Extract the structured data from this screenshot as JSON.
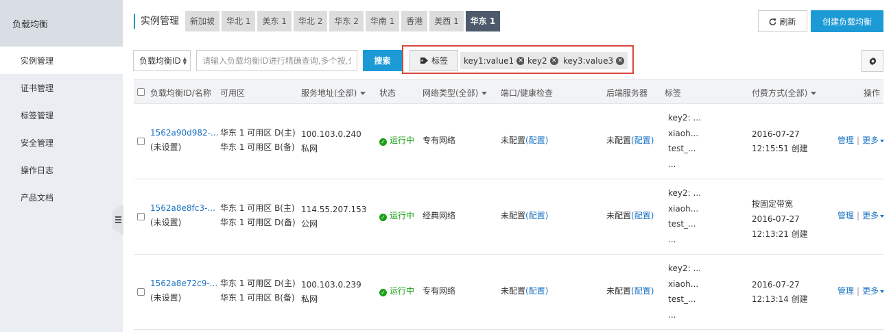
{
  "sidebar": {
    "title": "负载均衡",
    "items": [
      {
        "label": "实例管理",
        "active": true
      },
      {
        "label": "证书管理"
      },
      {
        "label": "标签管理"
      },
      {
        "label": "安全管理"
      },
      {
        "label": "操作日志"
      },
      {
        "label": "产品文档"
      }
    ]
  },
  "header": {
    "title": "实例管理",
    "regions": [
      "新加坡",
      "华北 1",
      "美东 1",
      "华北 2",
      "华东 2",
      "华南 1",
      "香港",
      "美西 1",
      "华东 1"
    ],
    "active_region": "华东 1",
    "refresh_label": "刷新",
    "create_label": "创建负载均衡"
  },
  "filter": {
    "select_value": "负载均衡ID",
    "search_placeholder": "请输入负载均衡ID进行精确查询,多个按,分",
    "search_label": "搜索",
    "tag_label": "标签",
    "tag_chips": [
      "key1:value1",
      "key2",
      "key3:value3"
    ]
  },
  "table": {
    "headers": {
      "id_name": "负载均衡ID/名称",
      "zone": "可用区",
      "address": "服务地址(全部)",
      "status": "状态",
      "network": "网络类型(全部)",
      "port": "端口/健康检查",
      "backend": "后端服务器",
      "tags": "标签",
      "billing": "付费方式(全部)",
      "actions": "操作"
    },
    "rows": [
      {
        "id": "1562a90d982-...",
        "name": "(未设置)",
        "zone_main": "华东 1 可用区 D(主)",
        "zone_backup": "华东 1 可用区 B(备)",
        "ip": "100.103.0.240",
        "ip_type": "私网",
        "status": "运行中",
        "network": "专有网络",
        "port_prefix": "未配置",
        "port_link": "(配置)",
        "backend_prefix": "未配置",
        "backend_link": "(配置)",
        "tags": [
          "key2: ...",
          "xiaoh...",
          "test_...",
          "..."
        ],
        "billing_note": "",
        "billing_date": "2016-07-27",
        "billing_time": "12:15:51 创建",
        "manage": "管理",
        "more": "更多"
      },
      {
        "id": "1562a8e8fc3-...",
        "name": "(未设置)",
        "zone_main": "华东 1 可用区 B(主)",
        "zone_backup": "华东 1 可用区 D(备)",
        "ip": "114.55.207.153",
        "ip_type": "公网",
        "status": "运行中",
        "network": "经典网络",
        "port_prefix": "未配置",
        "port_link": "(配置)",
        "backend_prefix": "未配置",
        "backend_link": "(配置)",
        "tags": [
          "key2: ...",
          "xiaoh...",
          "test_...",
          "..."
        ],
        "billing_note": "按固定带宽",
        "billing_date": "2016-07-27",
        "billing_time": "12:13:21 创建",
        "manage": "管理",
        "more": "更多"
      },
      {
        "id": "1562a8e72c9-...",
        "name": "(未设置)",
        "zone_main": "华东 1 可用区 D(主)",
        "zone_backup": "华东 1 可用区 B(备)",
        "ip": "100.103.0.239",
        "ip_type": "私网",
        "status": "运行中",
        "network": "专有网络",
        "port_prefix": "未配置",
        "port_link": "(配置)",
        "backend_prefix": "未配置",
        "backend_link": "(配置)",
        "tags": [
          "key2: ...",
          "xiaoh...",
          "test_...",
          "..."
        ],
        "billing_note": "",
        "billing_date": "2016-07-27",
        "billing_time": "12:13:14 创建",
        "manage": "管理",
        "more": "更多"
      }
    ]
  },
  "colors": {
    "accent": "#1c9ad6",
    "link": "#1c74c4",
    "status_ok": "#19a015",
    "highlight_border": "#d9453a",
    "active_tab": "#4c5a6b"
  }
}
